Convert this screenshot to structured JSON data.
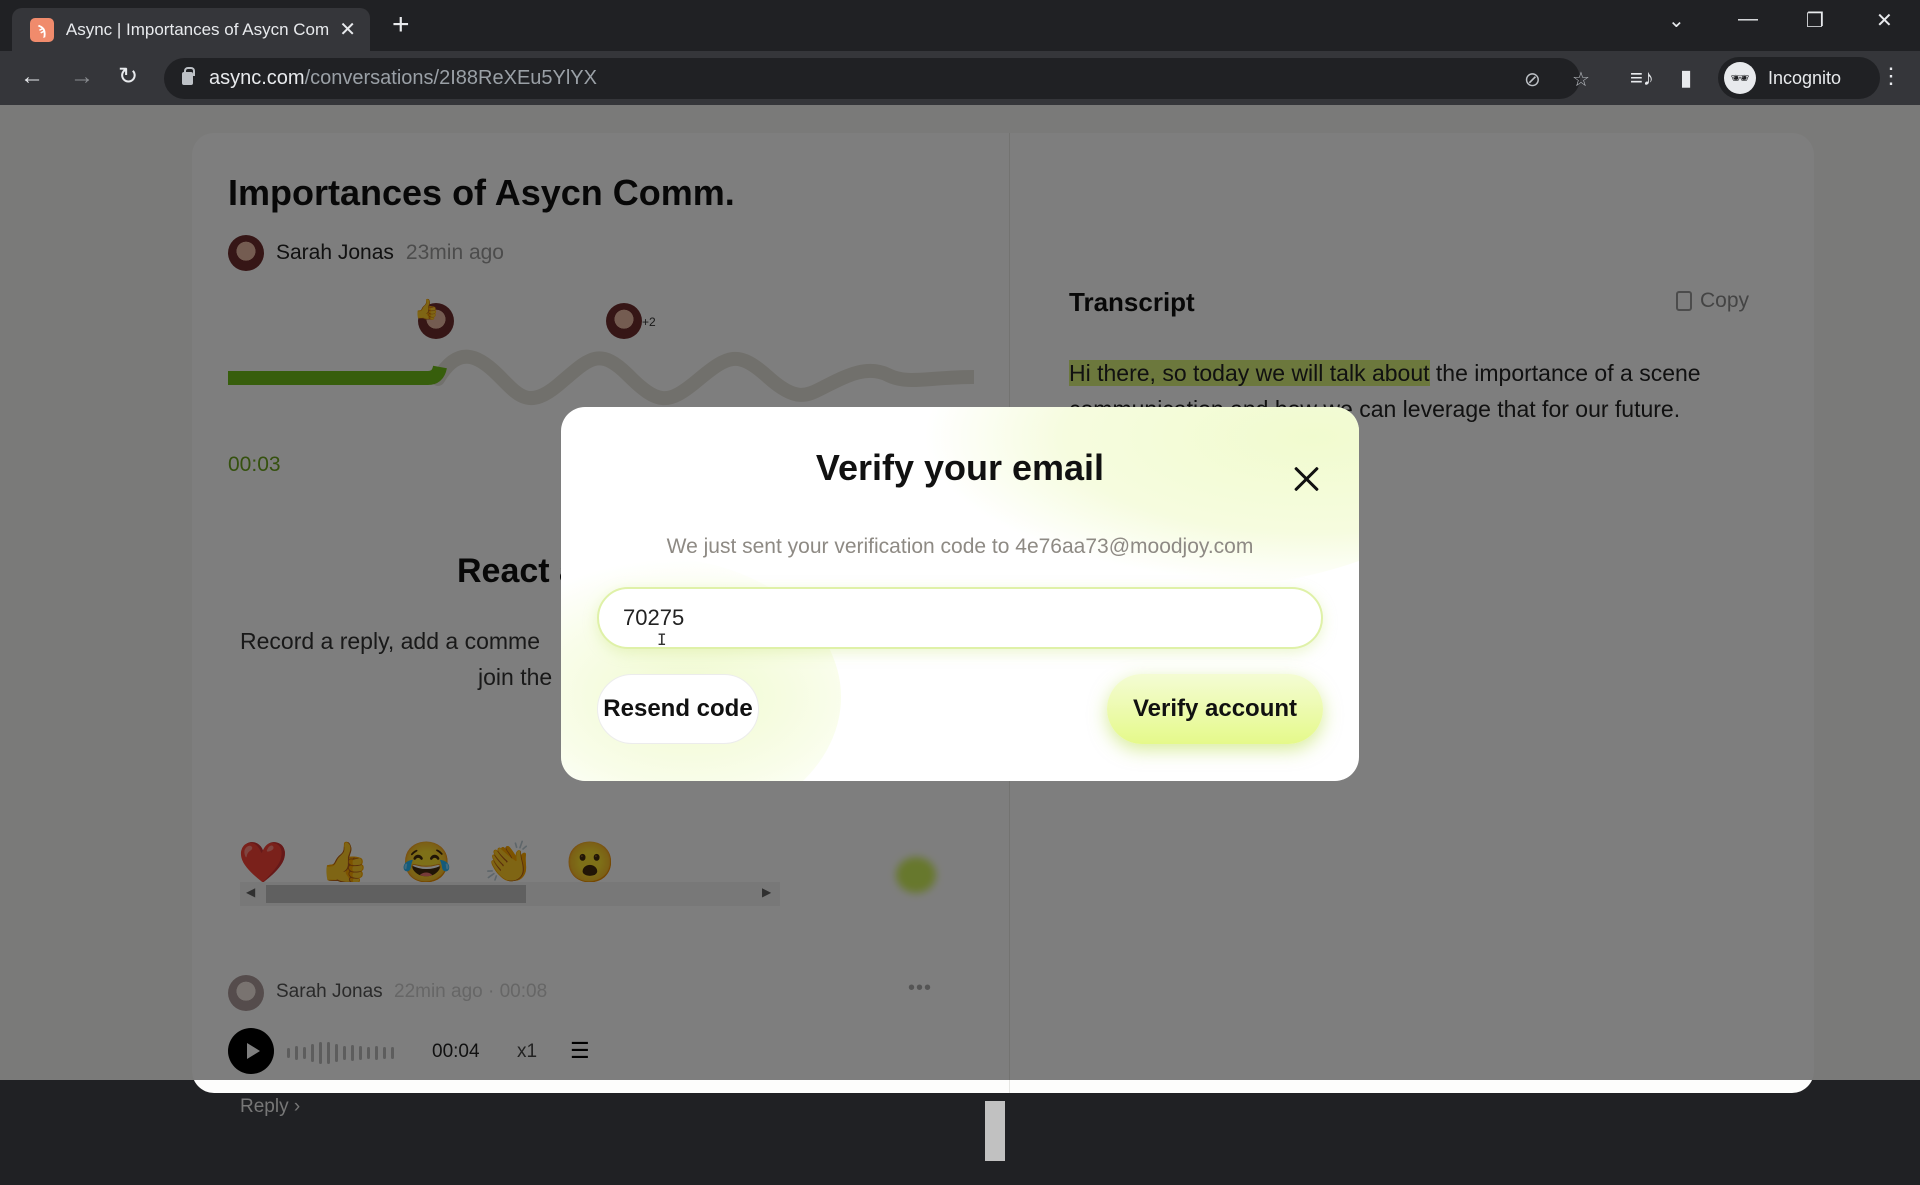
{
  "browser": {
    "tab_title": "Async | Importances of Asycn Comm.",
    "tab_favicon": "async-logo-icon",
    "url_host": "async.com",
    "url_path": "/conversations/2I88ReXEu5YlYX",
    "profile_label": "Incognito",
    "icons": {
      "back": "←",
      "forward": "→",
      "reload": "↻",
      "new_tab": "+",
      "tab_close": "✕",
      "tab_search": "⌄",
      "minimize": "—",
      "restore": "❐",
      "window_close": "✕",
      "eye_off": "⊘",
      "bookmark": "☆",
      "media": "≡♪",
      "side_panel": "▮",
      "menu": "⋮",
      "incognito": "🕶"
    }
  },
  "conversation": {
    "title": "Importances of Asycn Comm.",
    "author": "Sarah Jonas",
    "time_ago": "23min ago",
    "reaction_extra_count": "+2",
    "current_time": "00:03",
    "progress_fraction": 0.28
  },
  "react_section": {
    "title": "React a",
    "subtitle_line1": "Record a reply, add a comme",
    "subtitle_line2": "join the",
    "emojis": [
      "❤️",
      "👍",
      "😂",
      "👏",
      "😮"
    ]
  },
  "comment": {
    "author": "Sarah Jonas",
    "meta": "22min ago · 00:08",
    "more": "•••",
    "duration": "00:04",
    "speed": "x1",
    "transcript_icon": "☰",
    "reply_label": "Reply ›"
  },
  "transcript": {
    "title": "Transcript",
    "copy_label": "Copy",
    "highlighted_text": "Hi there, so today we will talk about",
    "rest_text": " the importance of a scene communication and how we can leverage that for our future."
  },
  "modal": {
    "title": "Verify your email",
    "message": "We just sent your verification code to 4e76aa73@moodjoy.com",
    "code_value": "70275",
    "resend_label": "Resend code",
    "verify_label": "Verify account",
    "close_icon": "close-icon"
  },
  "colors": {
    "accent_green": "#6aa31d",
    "highlight": "#d9f07a",
    "verify_button": "#e5f98a",
    "overlay": "rgba(0,0,0,0.5)"
  }
}
